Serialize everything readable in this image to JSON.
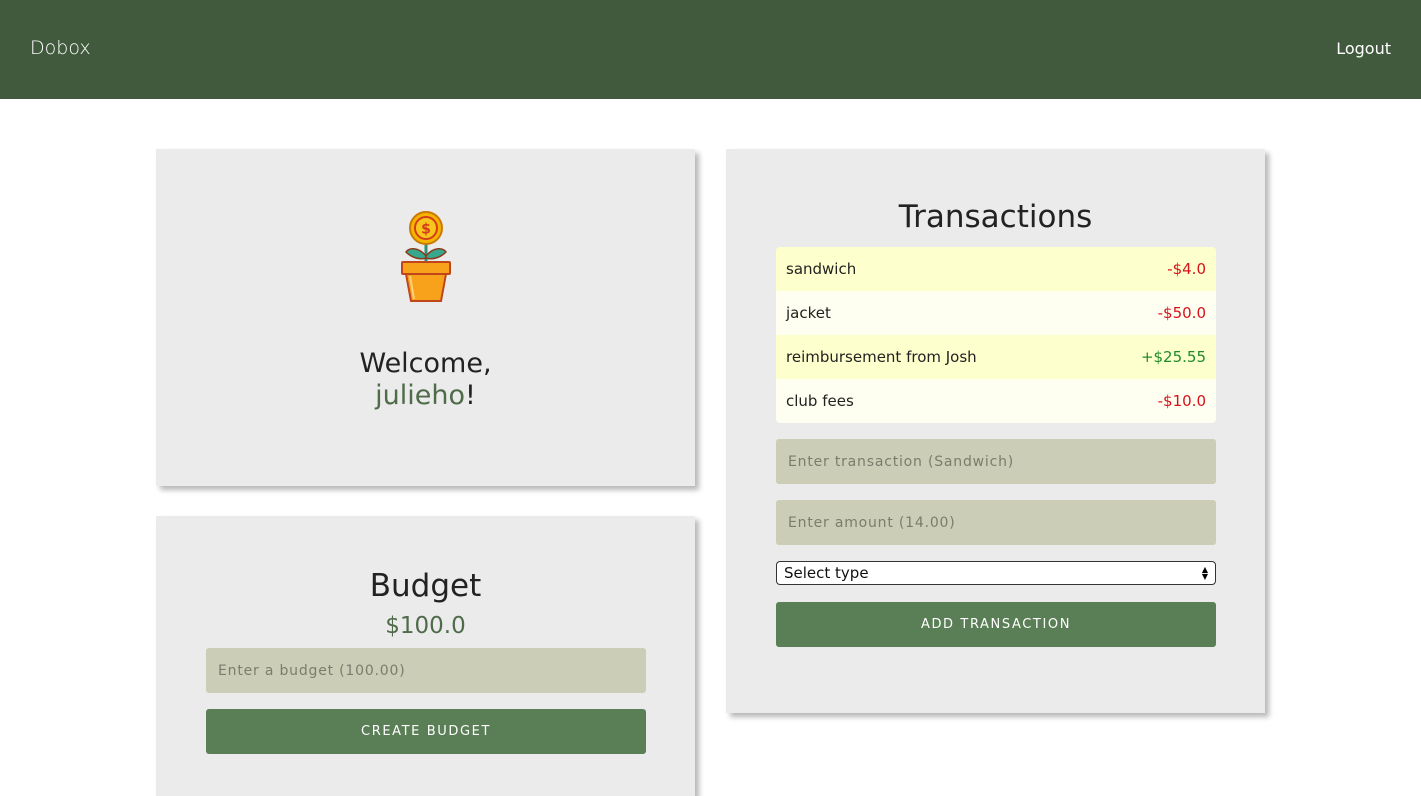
{
  "navbar": {
    "brand": "Dobox",
    "logout_label": "Logout",
    "color": "#415a3d"
  },
  "welcome": {
    "greeting": "Welcome,",
    "username": "julieho",
    "suffix": "!",
    "icon": "money-plant-icon"
  },
  "budget": {
    "title": "Budget",
    "amount": "$100.0",
    "input_placeholder": "Enter a budget (100.00)",
    "button_label": "CREATE BUDGET"
  },
  "transactions": {
    "title": "Transactions",
    "items": [
      {
        "name": "sandwich",
        "amount": "-$4.0",
        "kind": "expense"
      },
      {
        "name": "jacket",
        "amount": "-$50.0",
        "kind": "expense"
      },
      {
        "name": "reimbursement from Josh",
        "amount": "+$25.55",
        "kind": "income"
      },
      {
        "name": "club fees",
        "amount": "-$10.0",
        "kind": "expense"
      }
    ],
    "name_placeholder": "Enter transaction (Sandwich)",
    "amount_placeholder": "Enter amount (14.00)",
    "type_select": "Select type",
    "button_label": "ADD TRANSACTION"
  },
  "colors": {
    "accent": "#5a7e55",
    "input_bg": "#cbcdb6",
    "card_bg": "#ebebeb",
    "expense": "#d9111b",
    "income": "#1f8c2a"
  }
}
